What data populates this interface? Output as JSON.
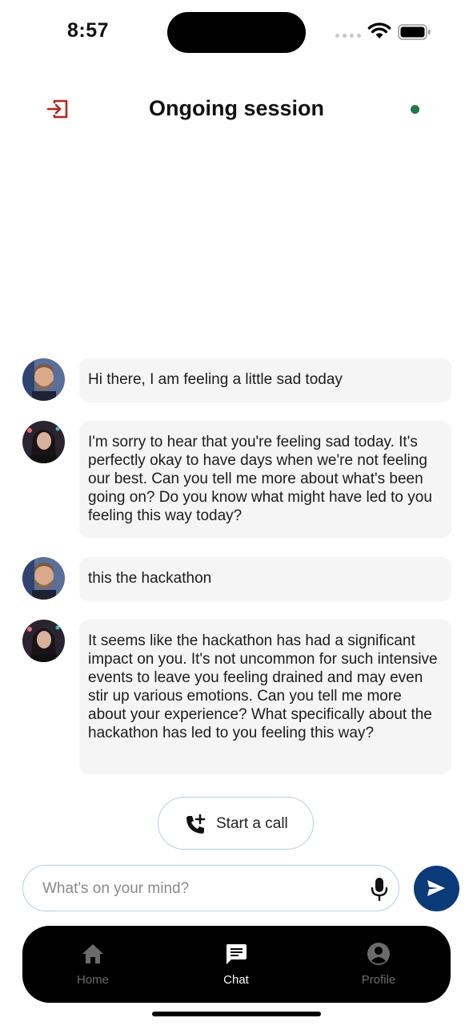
{
  "status_bar": {
    "time": "8:57"
  },
  "header": {
    "title": "Ongoing session",
    "status_color": "#1e7a46"
  },
  "messages": [
    {
      "sender": "user",
      "text": "Hi there, I am feeling a little sad today"
    },
    {
      "sender": "therapist",
      "text": "I'm sorry to hear that you're feeling sad today. It's perfectly okay to have days when we're not feeling our best. Can you tell me more about what's been going on? Do you know what might have led to you feeling this way today?"
    },
    {
      "sender": "user",
      "text": "this the hackathon"
    },
    {
      "sender": "therapist",
      "text": "It seems like the hackathon has had a significant impact on you. It's not uncommon for such intensive events to leave you feeling drained and may even stir up various emotions. Can you tell me more about your experience? What specifically about the hackathon has led to you feeling this way?"
    }
  ],
  "call_button": {
    "label": "Start a call"
  },
  "composer": {
    "placeholder": "What's on your mind?",
    "value": ""
  },
  "tabs": [
    {
      "label": "Home",
      "icon": "home-icon",
      "active": false
    },
    {
      "label": "Chat",
      "icon": "chat-icon",
      "active": true
    },
    {
      "label": "Profile",
      "icon": "profile-icon",
      "active": false
    }
  ],
  "colors": {
    "accent": "#0b3a78",
    "exit_icon": "#b3261e",
    "bubble_bg": "#f5f5f5",
    "tab_active": "#ffffff",
    "tab_inactive": "#6b6b6b"
  }
}
